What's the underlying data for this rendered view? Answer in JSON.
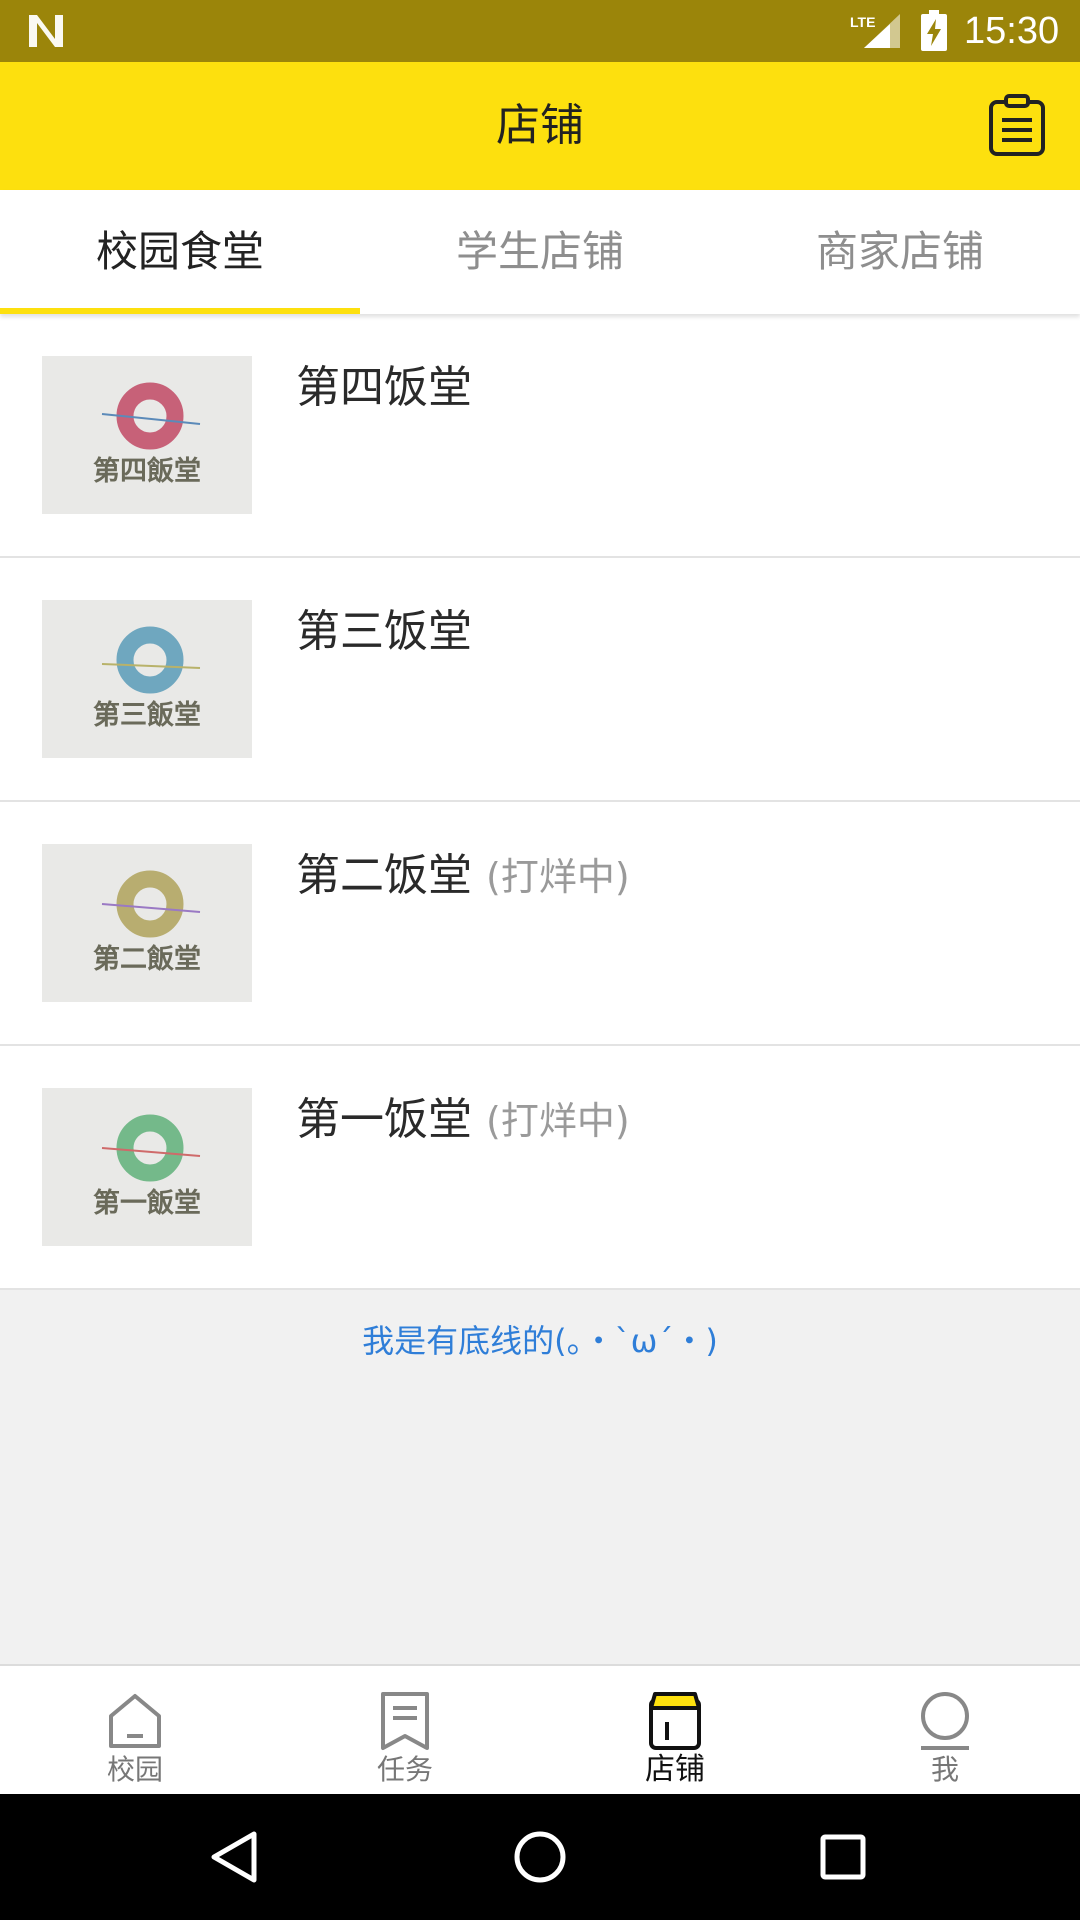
{
  "status_bar": {
    "time": "15:30",
    "network_label": "LTE",
    "icons": [
      "notification-n-icon",
      "signal-icon",
      "battery-charging-icon"
    ]
  },
  "app_bar": {
    "title": "店铺",
    "action_icon": "order-list-icon"
  },
  "tabs": [
    {
      "label": "校园食堂",
      "active": true
    },
    {
      "label": "学生店铺",
      "active": false
    },
    {
      "label": "商家店铺",
      "active": false
    }
  ],
  "shops": [
    {
      "name": "第四饭堂",
      "status": "",
      "logo_text": "第四飯堂",
      "ring_color": "#c76178",
      "line_color": "#5b8ab9"
    },
    {
      "name": "第三饭堂",
      "status": "",
      "logo_text": "第三飯堂",
      "ring_color": "#6fa7bf",
      "line_color": "#b8b26a"
    },
    {
      "name": "第二饭堂",
      "status": "(打烊中)",
      "logo_text": "第二飯堂",
      "ring_color": "#b8ad70",
      "line_color": "#9a79c4"
    },
    {
      "name": "第一饭堂",
      "status": "(打烊中)",
      "logo_text": "第一飯堂",
      "ring_color": "#74b98a",
      "line_color": "#cf6a6a"
    }
  ],
  "footer_note": "我是有底线的(。・`ω´・)",
  "bottom_nav": [
    {
      "label": "校园",
      "icon": "home-icon",
      "active": false
    },
    {
      "label": "任务",
      "icon": "task-icon",
      "active": false
    },
    {
      "label": "店铺",
      "icon": "shop-icon",
      "active": true
    },
    {
      "label": "我",
      "icon": "profile-icon",
      "active": false
    }
  ],
  "colors": {
    "status_bar": "#9b850a",
    "accent_yellow": "#fde00e",
    "link_blue": "#2f7ed8"
  }
}
